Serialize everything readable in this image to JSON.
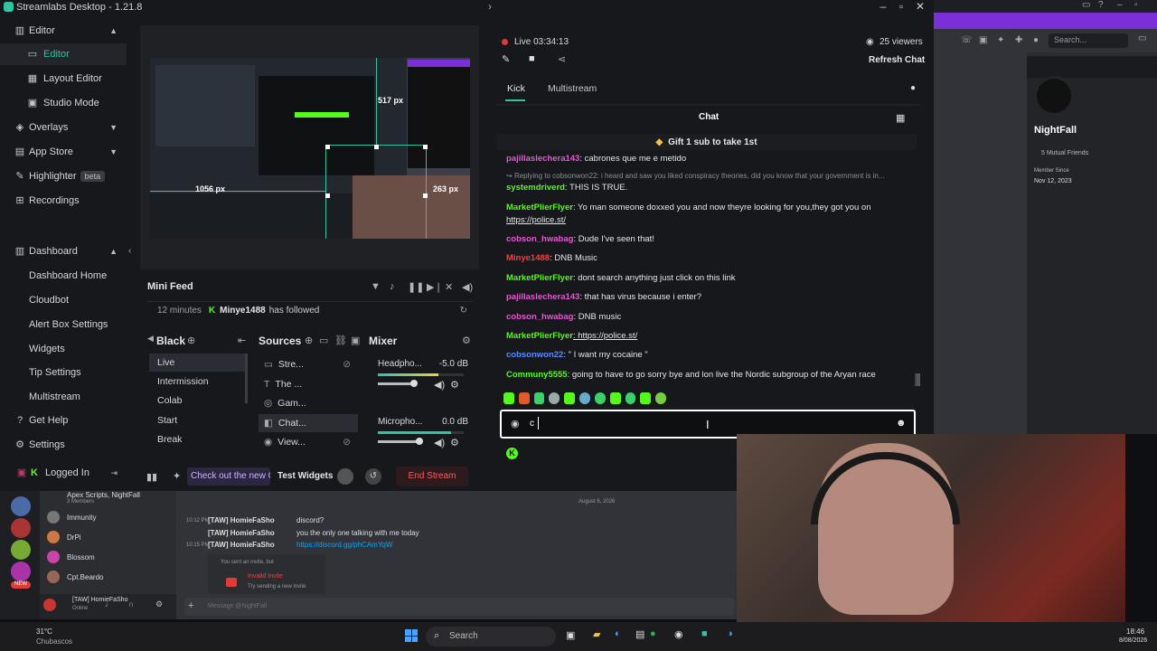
{
  "window": {
    "title": "Streamlabs Desktop - 1.21.8"
  },
  "sidebar": {
    "editor_section": "Editor",
    "items": [
      {
        "label": "Editor",
        "icon": "monitor-icon"
      },
      {
        "label": "Layout Editor",
        "icon": "layout-icon"
      },
      {
        "label": "Studio Mode",
        "icon": "studio-icon"
      }
    ],
    "overlays": "Overlays",
    "app_store": "App Store",
    "highlighter": "Highlighter",
    "beta": "beta",
    "recordings": "Recordings",
    "dashboard_section": "Dashboard",
    "dashboard_items": [
      "Dashboard Home",
      "Cloudbot",
      "Alert Box Settings",
      "Widgets",
      "Tip Settings",
      "Multistream"
    ],
    "get_help": "Get Help",
    "settings": "Settings",
    "logged_in": "Logged In"
  },
  "preview": {
    "measure_width": "517 px",
    "measure_left": "1056 px",
    "measure_height": "263 px"
  },
  "minifeed": {
    "title": "Mini Feed",
    "time": "12 minutes",
    "user": "Minye1488",
    "action": "has followed"
  },
  "scenes": {
    "title": "Black",
    "items": [
      "Live",
      "Intermission",
      "Colab",
      "Start",
      "Break"
    ]
  },
  "sources": {
    "title": "Sources",
    "items": [
      "Stre...",
      "The ...",
      "Gam...",
      "Chat...",
      "View..."
    ]
  },
  "mixer": {
    "title": "Mixer",
    "channels": [
      {
        "name": "Headpho...",
        "level": "-5.0 dB",
        "fill": 0.7
      },
      {
        "name": "Micropho...",
        "level": "0.0 dB",
        "fill": 0.85
      }
    ]
  },
  "footer": {
    "promo": "Check out the new C",
    "test_widgets": "Test Widgets",
    "end_stream": "End Stream"
  },
  "live": {
    "status": "Live 03:34:13",
    "viewers": "25 viewers",
    "refresh": "Refresh Chat"
  },
  "chat_tabs": [
    "Kick",
    "Multistream"
  ],
  "chat": {
    "title": "Chat",
    "pinned": "Gift 1 sub to take 1st",
    "input_value": "c",
    "messages": [
      {
        "user": "pajillaslechera143",
        "text": ": cabrones que me e metido",
        "color": "pink"
      },
      {
        "user": "",
        "text": "Replying to cobsonwon22: i heard and saw you liked conspiracy theories, did you know that your government is in...",
        "color": "reply"
      },
      {
        "user": "systemdriverd",
        "text": ": THIS IS TRUE.",
        "color": "green"
      },
      {
        "user": "MarketPlierFlyer",
        "text": ": Yo man someone doxxed you and now theyre looking for you,they got you on",
        "color": "green"
      },
      {
        "user": "",
        "text": "https://police.st/",
        "color": "link"
      },
      {
        "user": "cobson_hwabag",
        "text": ": Dude I've seen that!",
        "color": "pink"
      },
      {
        "user": "Minye1488",
        "text": ": DNB Music",
        "color": "pink"
      },
      {
        "user": "MarketPlierFlyer",
        "text": ": dont search anything just click on this link",
        "color": "green"
      },
      {
        "user": "pajillaslechera143",
        "text": ": that has virus because i enter?",
        "color": "pink"
      },
      {
        "user": "cobson_hwabag",
        "text": ": DNB music",
        "color": "pink"
      },
      {
        "user": "MarketPlierFlyer",
        "text": ": https://police.st/",
        "color": "green"
      },
      {
        "user": "cobsonwon22",
        "text": ": \" I want my cocaine \"",
        "color": "blue"
      },
      {
        "user": "Communy5555",
        "text": ": going to have to go sorry bye and lon live the Nordic subgroup of the Aryan race",
        "color": "green"
      }
    ]
  },
  "discord_right": {
    "search": "Search...",
    "name": "NightFall",
    "mutual": "5 Mutual Friends",
    "member_since_label": "Member Since",
    "member_since": "Nov 12, 2023"
  },
  "discord_bottom": {
    "server": "Apex Scripts, NightFall",
    "members": "3 Members",
    "dm_list": [
      "Immunity",
      "DrPi",
      "Blossom",
      "Cpt.Beardo"
    ],
    "date_divider": "August 6, 2026",
    "lines": [
      {
        "time": "10:12 PM",
        "user": "[TAW] HomieFaSho",
        "text": "discord?"
      },
      {
        "time": "",
        "user": "[TAW] HomieFaSho",
        "text": "you the only one talking with me today"
      },
      {
        "time": "10:15 PM",
        "user": "[TAW] HomieFaSho",
        "text": "https://discord.gg/phCAmYqW"
      }
    ],
    "invite_sent": "You sent an invite, but",
    "invite_invalid": "Invalid Invite",
    "invite_try": "Try sending a new invite",
    "self_name": "[TAW] HomieFaSho",
    "self_status": "Online",
    "message_placeholder": "Message @NightFall"
  },
  "taskbar": {
    "weather_temp": "31°C",
    "weather_desc": "Chubascos",
    "search": "Search",
    "time": "18:46",
    "date": "8/08/2026"
  }
}
